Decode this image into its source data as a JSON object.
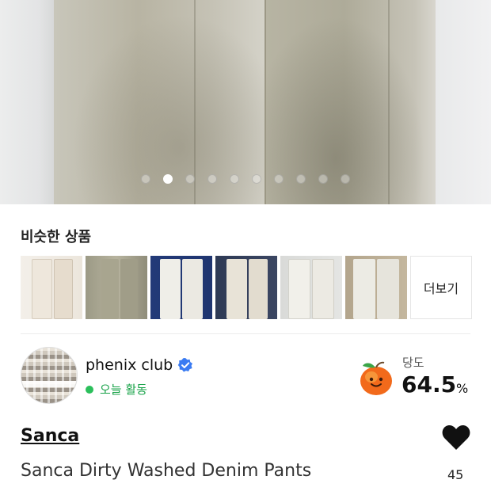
{
  "gallery": {
    "dot_count": 10,
    "active_index": 1
  },
  "similar": {
    "title": "비슷한 상품",
    "more_label": "더보기"
  },
  "seller": {
    "name": "phenix club",
    "status": "오늘 활동",
    "sweetness_label": "당도",
    "sweetness_value": "64.5",
    "sweetness_unit": "%"
  },
  "product": {
    "brand": "Sanca",
    "name": "Sanca Dirty Washed Denim Pants",
    "likes": "45"
  },
  "colors": {
    "active_status": "#2bbf5b",
    "verified": "#3a7bf2"
  }
}
